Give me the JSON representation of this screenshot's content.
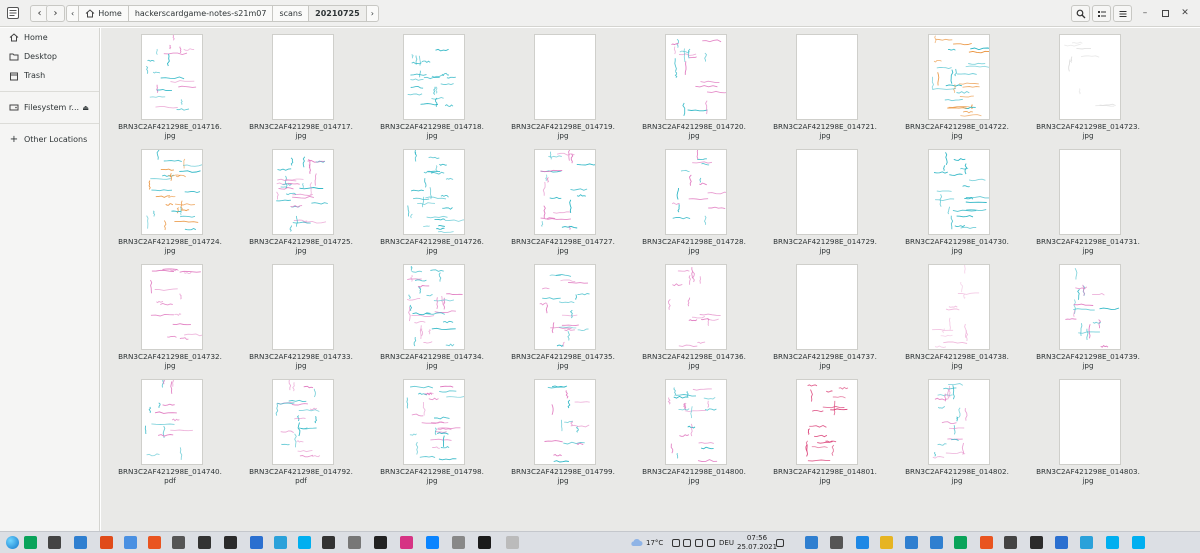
{
  "header": {
    "breadcrumb": [
      "Home",
      "hackerscardgame-notes-s21m07",
      "scans",
      "20210725"
    ],
    "back_icon": "chevron-left-icon",
    "forward_icon": "chevron-right-icon"
  },
  "sidebar": {
    "items": [
      {
        "label": "Home",
        "icon": "home-icon"
      },
      {
        "label": "Desktop",
        "icon": "desktop-icon"
      },
      {
        "label": "Trash",
        "icon": "trash-icon"
      },
      {
        "label": "Filesystem r...",
        "icon": "drive-icon"
      },
      {
        "label": "Other Locations",
        "icon": "plus-icon"
      }
    ]
  },
  "files": [
    {
      "name": "BRN3C2AF421298E_014716.",
      "ext": "jpg",
      "ink": [
        "#2ab5c4",
        "#e07ac0"
      ],
      "density": 0.5
    },
    {
      "name": "BRN3C2AF421298E_014717.",
      "ext": "jpg",
      "ink": [],
      "density": 0
    },
    {
      "name": "BRN3C2AF421298E_014718.",
      "ext": "jpg",
      "ink": [
        "#2ab5c4"
      ],
      "density": 0.6
    },
    {
      "name": "BRN3C2AF421298E_014719.",
      "ext": "jpg",
      "ink": [],
      "density": 0
    },
    {
      "name": "BRN3C2AF421298E_014720.",
      "ext": "jpg",
      "ink": [
        "#e07ac0",
        "#2ab5c4"
      ],
      "density": 0.5
    },
    {
      "name": "BRN3C2AF421298E_014721.",
      "ext": "jpg",
      "ink": [],
      "density": 0
    },
    {
      "name": "BRN3C2AF421298E_014722.",
      "ext": "jpg",
      "ink": [
        "#e8892b",
        "#2ab5c4"
      ],
      "density": 0.9
    },
    {
      "name": "BRN3C2AF421298E_014723.",
      "ext": "jpg",
      "ink": [
        "#dddddd"
      ],
      "density": 0.1
    },
    {
      "name": "BRN3C2AF421298E_014724.",
      "ext": "jpg",
      "ink": [
        "#e8892b",
        "#2ab5c4"
      ],
      "density": 0.9
    },
    {
      "name": "BRN3C2AF421298E_014725.",
      "ext": "jpg",
      "ink": [
        "#2ab5c4",
        "#e07ac0"
      ],
      "density": 1.0
    },
    {
      "name": "BRN3C2AF421298E_014726.",
      "ext": "jpg",
      "ink": [
        "#2ab5c4"
      ],
      "density": 0.8
    },
    {
      "name": "BRN3C2AF421298E_014727.",
      "ext": "jpg",
      "ink": [
        "#2ab5c4",
        "#e07ac0"
      ],
      "density": 0.6
    },
    {
      "name": "BRN3C2AF421298E_014728.",
      "ext": "jpg",
      "ink": [
        "#2ab5c4",
        "#e07ac0"
      ],
      "density": 0.4
    },
    {
      "name": "BRN3C2AF421298E_014729.",
      "ext": "jpg",
      "ink": [],
      "density": 0
    },
    {
      "name": "BRN3C2AF421298E_014730.",
      "ext": "jpg",
      "ink": [
        "#2ab5c4"
      ],
      "density": 0.6
    },
    {
      "name": "BRN3C2AF421298E_014731.",
      "ext": "jpg",
      "ink": [],
      "density": 0
    },
    {
      "name": "BRN3C2AF421298E_014732.",
      "ext": "jpg",
      "ink": [
        "#e07ac0"
      ],
      "density": 0.4
    },
    {
      "name": "BRN3C2AF421298E_014733.",
      "ext": "jpg",
      "ink": [],
      "density": 0
    },
    {
      "name": "BRN3C2AF421298E_014734.",
      "ext": "jpg",
      "ink": [
        "#e07ac0",
        "#2ab5c4"
      ],
      "density": 1.0
    },
    {
      "name": "BRN3C2AF421298E_014735.",
      "ext": "jpg",
      "ink": [
        "#2ab5c4",
        "#e07ac0"
      ],
      "density": 0.6
    },
    {
      "name": "BRN3C2AF421298E_014736.",
      "ext": "jpg",
      "ink": [
        "#e07ac0"
      ],
      "density": 0.4
    },
    {
      "name": "BRN3C2AF421298E_014737.",
      "ext": "jpg",
      "ink": [],
      "density": 0
    },
    {
      "name": "BRN3C2AF421298E_014738.",
      "ext": "jpg",
      "ink": [
        "#f0b8dc"
      ],
      "density": 0.3
    },
    {
      "name": "BRN3C2AF421298E_014739.",
      "ext": "jpg",
      "ink": [
        "#2ab5c4",
        "#e07ac0"
      ],
      "density": 0.5
    },
    {
      "name": "BRN3C2AF421298E_014740.",
      "ext": "pdf",
      "ink": [
        "#2ab5c4",
        "#e07ac0"
      ],
      "density": 0.4
    },
    {
      "name": "BRN3C2AF421298E_014792.",
      "ext": "pdf",
      "ink": [
        "#2ab5c4",
        "#e07ac0"
      ],
      "density": 0.7
    },
    {
      "name": "BRN3C2AF421298E_014798.",
      "ext": "jpg",
      "ink": [
        "#2ab5c4",
        "#e07ac0"
      ],
      "density": 0.8
    },
    {
      "name": "BRN3C2AF421298E_014799.",
      "ext": "jpg",
      "ink": [
        "#2ab5c4",
        "#e07ac0"
      ],
      "density": 0.4
    },
    {
      "name": "BRN3C2AF421298E_014800.",
      "ext": "jpg",
      "ink": [
        "#2ab5c4",
        "#e07ac0"
      ],
      "density": 0.6
    },
    {
      "name": "BRN3C2AF421298E_014801.",
      "ext": "jpg",
      "ink": [
        "#d8336e"
      ],
      "density": 0.5
    },
    {
      "name": "BRN3C2AF421298E_014802.",
      "ext": "jpg",
      "ink": [
        "#2ab5c4",
        "#e07ac0"
      ],
      "density": 0.6
    },
    {
      "name": "BRN3C2AF421298E_014803.",
      "ext": "jpg",
      "ink": [],
      "density": 0
    }
  ],
  "taskbar": {
    "weather": "17°C",
    "lang": "DEU",
    "time": "07:56",
    "date": "25.07.2021",
    "icons": [
      "windows-start-icon",
      "edge-icon",
      "explorer-icon",
      "store-icon",
      "mail-icon",
      "chrome-icon",
      "ubuntu-icon",
      "app-icon",
      "inkscape-icon",
      "vpn-icon",
      "live-icon",
      "telegram-icon",
      "skype-icon",
      "terminal-icon",
      "vr-icon",
      "x-icon",
      "sketch-icon",
      "edge2-icon",
      "notes-icon",
      "console-icon",
      "files-icon"
    ],
    "right_icons": [
      "windows-start-icon",
      "search-icon",
      "edge-icon",
      "explorer-icon",
      "store-icon",
      "mail-icon",
      "chrome-icon",
      "ubuntu-icon",
      "app-icon",
      "inkscape-icon",
      "vpn-icon",
      "live-icon",
      "telegram-icon",
      "skype-icon"
    ],
    "colors": {
      "accent": "#2ab5c4",
      "pink": "#e07ac0",
      "orange": "#e8892b"
    }
  }
}
